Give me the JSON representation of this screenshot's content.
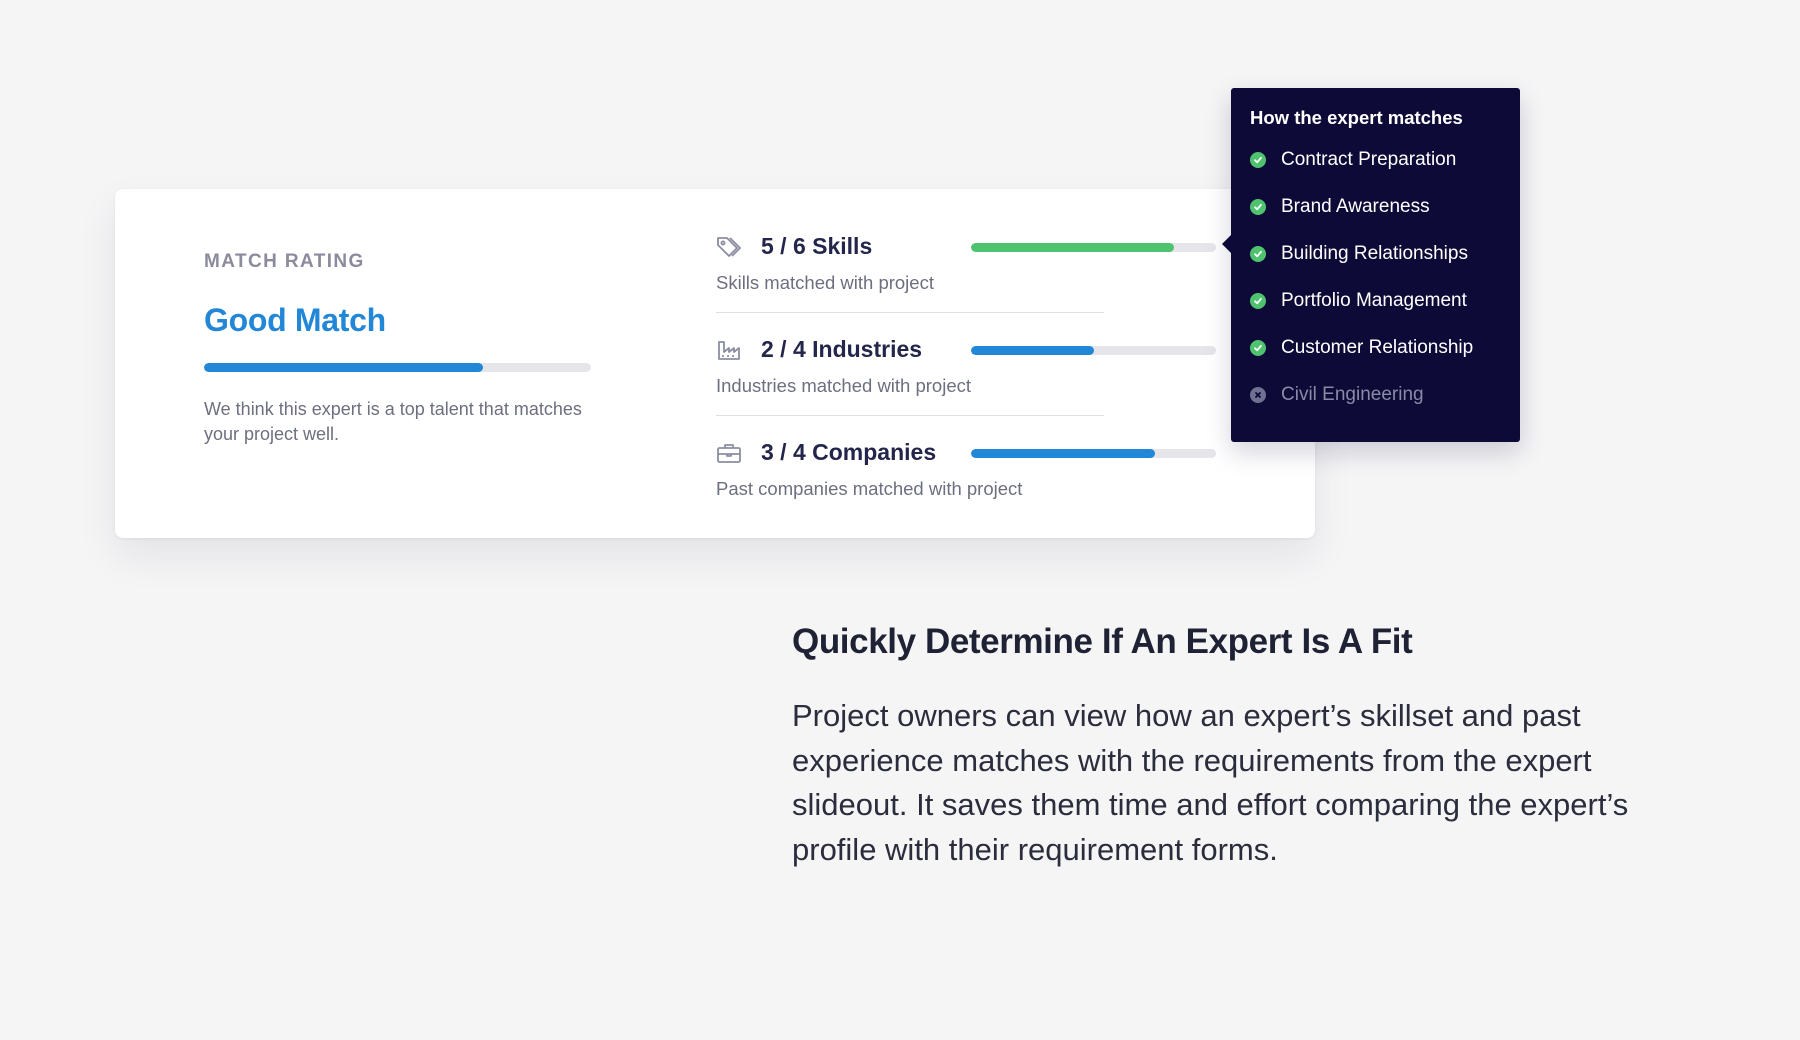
{
  "card": {
    "rating_label": "MATCH RATING",
    "rating_title": "Good Match",
    "rating_progress": 0.72,
    "rating_description": "We think this expert is a top talent that matches your project well.",
    "metrics": [
      {
        "title": "5 / 6 Skills",
        "subtitle": "Skills matched with project",
        "icon": "tag-icon",
        "progress": 0.83,
        "color": "#4fc26f"
      },
      {
        "title": "2 / 4 Industries",
        "subtitle": "Industries matched with project",
        "icon": "factory-icon",
        "progress": 0.5,
        "color": "#2387d8"
      },
      {
        "title": "3 / 4 Companies",
        "subtitle": "Past companies matched with project",
        "icon": "briefcase-icon",
        "progress": 0.75,
        "color": "#2387d8"
      }
    ]
  },
  "tooltip": {
    "title": "How the expert matches",
    "items": [
      {
        "label": "Contract Preparation",
        "matched": true
      },
      {
        "label": "Brand Awareness",
        "matched": true
      },
      {
        "label": "Building Relationships",
        "matched": true
      },
      {
        "label": "Portfolio Management",
        "matched": true
      },
      {
        "label": "Customer Relationship",
        "matched": true
      },
      {
        "label": "Civil Engineering",
        "matched": false
      }
    ]
  },
  "feature": {
    "heading": "Quickly Determine If An Expert Is A Fit",
    "body": "Project owners can view how an expert’s skillset and past experience matches with the requirements from the expert slideout. It saves them time and effort comparing the expert’s profile with their requirement forms."
  },
  "colors": {
    "accent": "#2387d8",
    "success": "#4fc26f",
    "tooltip_bg": "#0d0a37"
  }
}
